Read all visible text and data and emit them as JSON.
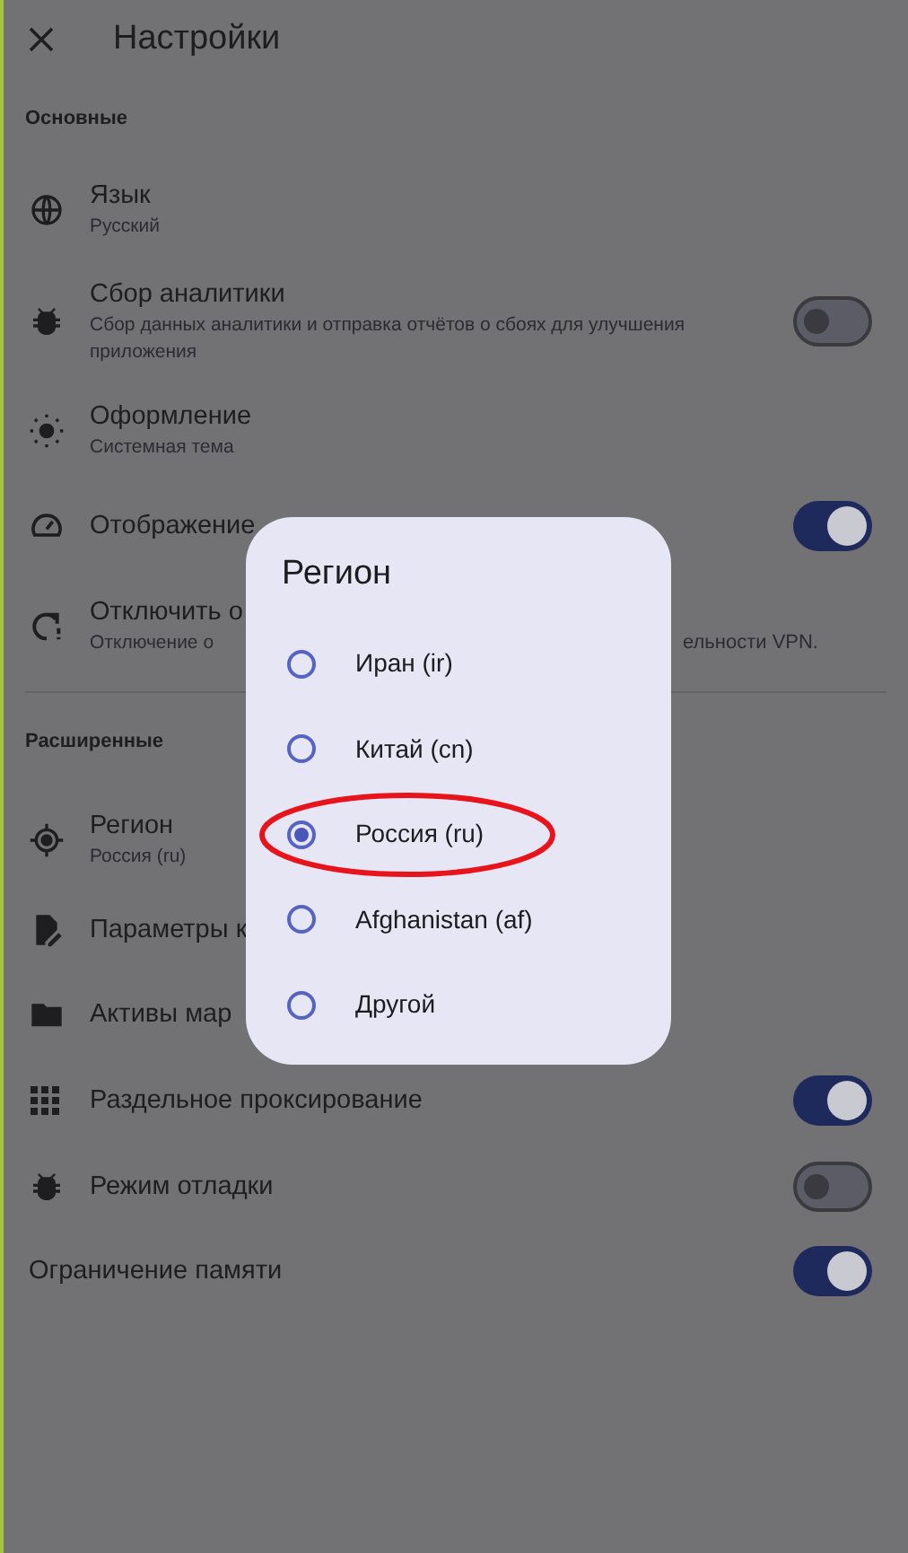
{
  "header": {
    "title": "Настройки"
  },
  "sections": [
    {
      "title": "Основные",
      "items": [
        {
          "kind": "nav",
          "title": "Язык",
          "subtitle": "Русский"
        },
        {
          "kind": "toggle",
          "title": "Сбор аналитики",
          "subtitle": "Сбор данных аналитики и отправка отчётов о сбоях для улучшения приложения",
          "on": false
        },
        {
          "kind": "nav",
          "title": "Оформление",
          "subtitle": "Системная тема"
        },
        {
          "kind": "toggle",
          "title": "Отображение",
          "on": true
        },
        {
          "kind": "nav",
          "title": "Отключить о",
          "subtitle": "Отключение о",
          "subtitle_end": "ельности VPN."
        }
      ]
    },
    {
      "title": "Расширенные",
      "items": [
        {
          "kind": "nav",
          "title": "Регион",
          "subtitle": "Россия (ru)"
        },
        {
          "kind": "nav",
          "title": "Параметры к"
        },
        {
          "kind": "nav",
          "title": "Активы мар"
        },
        {
          "kind": "toggle",
          "title": "Раздельное проксирование",
          "on": true
        },
        {
          "kind": "toggle",
          "title": "Режим отладки",
          "on": false
        },
        {
          "kind": "toggle",
          "title": "Ограничение памяти",
          "on": true
        }
      ]
    }
  ],
  "dialog": {
    "title": "Регион",
    "options": [
      {
        "label": "Иран (ir)",
        "selected": false,
        "circled": false
      },
      {
        "label": "Китай (cn)",
        "selected": false,
        "circled": false
      },
      {
        "label": "Россия (ru)",
        "selected": true,
        "circled": true
      },
      {
        "label": "Afghanistan (af)",
        "selected": false,
        "circled": false
      },
      {
        "label": "Другой",
        "selected": false,
        "circled": false
      }
    ]
  }
}
